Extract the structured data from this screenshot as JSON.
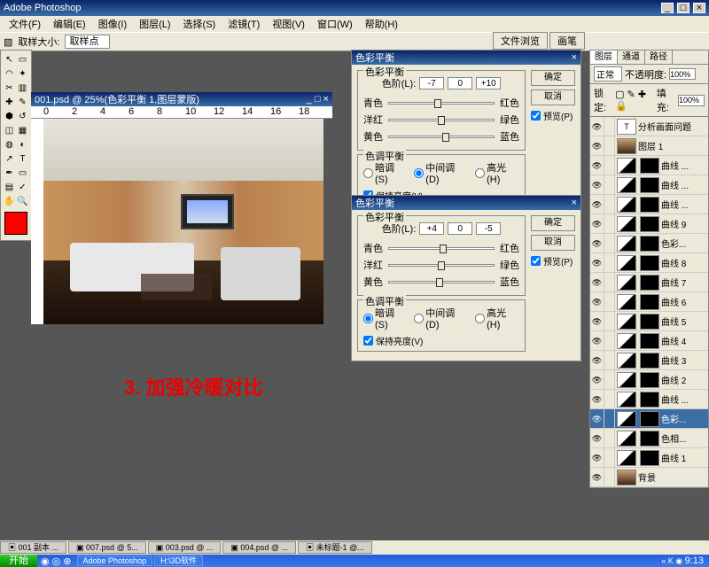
{
  "app": {
    "title": "Adobe Photoshop"
  },
  "menu": [
    "文件(F)",
    "编辑(E)",
    "图像(I)",
    "图层(L)",
    "选择(S)",
    "滤镜(T)",
    "视图(V)",
    "窗口(W)",
    "帮助(H)"
  ],
  "options": {
    "label": "取样大小:",
    "value": "取样点"
  },
  "topTabs": [
    "文件浏览",
    "画笔"
  ],
  "doc": {
    "title": "001.psd @ 25%(色彩平衡 1,图层蒙版)",
    "rulerMarks": [
      "0",
      "2",
      "4",
      "6",
      "8",
      "10",
      "12",
      "14",
      "16",
      "18"
    ]
  },
  "annotation": "3. 加强冷暖对比",
  "dlg1": {
    "title": "色彩平衡",
    "group1": "色彩平衡",
    "levelsLabel": "色阶(L):",
    "l1": "-7",
    "l2": "0",
    "l3": "+10",
    "rows": [
      [
        "青色",
        "红色"
      ],
      [
        "洋红",
        "绿色"
      ],
      [
        "黄色",
        "蓝色"
      ]
    ],
    "thumbs": [
      47,
      50,
      54
    ],
    "group2": "色调平衡",
    "radios": [
      "暗调(S)",
      "中间调(D)",
      "高光(H)"
    ],
    "radioSel": 1,
    "preserve": "保持亮度(V)",
    "ok": "确定",
    "cancel": "取消",
    "preview": "预览(P)"
  },
  "dlg2": {
    "title": "色彩平衡",
    "group1": "色彩平衡",
    "levelsLabel": "色阶(L):",
    "l1": "+4",
    "l2": "0",
    "l3": "-5",
    "rows": [
      [
        "青色",
        "红色"
      ],
      [
        "洋红",
        "绿色"
      ],
      [
        "黄色",
        "蓝色"
      ]
    ],
    "thumbs": [
      52,
      50,
      48
    ],
    "group2": "色调平衡",
    "radios": [
      "暗调(S)",
      "中间调(D)",
      "高光(H)"
    ],
    "radioSel": 0,
    "preserve": "保持亮度(V)",
    "ok": "确定",
    "cancel": "取消",
    "preview": "预览(P)"
  },
  "palette": {
    "tabs": [
      "图层",
      "通道",
      "路径"
    ],
    "blend": "正常",
    "opacityLabel": "不透明度:",
    "opacity": "100%",
    "lockLabel": "锁定:",
    "fillLabel": "填充:",
    "fill": "100%",
    "layers": [
      {
        "type": "text",
        "name": "分析画面问题",
        "th": "T"
      },
      {
        "type": "normal",
        "name": "图层 1",
        "th": "img"
      },
      {
        "type": "adj",
        "name": "曲线 ...",
        "th": "curve",
        "mask": true
      },
      {
        "type": "adj",
        "name": "曲线 ...",
        "th": "curve",
        "mask": true
      },
      {
        "type": "adj",
        "name": "曲线 ...",
        "th": "curve",
        "mask": true
      },
      {
        "type": "adj",
        "name": "曲线 9",
        "th": "curve",
        "mask": true
      },
      {
        "type": "adj",
        "name": "色彩...",
        "th": "curve",
        "mask": true
      },
      {
        "type": "adj",
        "name": "曲线 8",
        "th": "curve",
        "mask": true
      },
      {
        "type": "adj",
        "name": "曲线 7",
        "th": "curve",
        "mask": true
      },
      {
        "type": "adj",
        "name": "曲线 6",
        "th": "curve",
        "mask": true
      },
      {
        "type": "adj",
        "name": "曲线 5",
        "th": "curve",
        "mask": true
      },
      {
        "type": "adj",
        "name": "曲线 4",
        "th": "curve",
        "mask": true
      },
      {
        "type": "adj",
        "name": "曲线 3",
        "th": "curve",
        "mask": true
      },
      {
        "type": "adj",
        "name": "曲线 2",
        "th": "curve",
        "mask": true
      },
      {
        "type": "adj",
        "name": "曲线 ...",
        "th": "curve",
        "mask": true
      },
      {
        "type": "adj",
        "name": "色彩...",
        "th": "curve",
        "mask": true,
        "sel": true
      },
      {
        "type": "adj",
        "name": "色相...",
        "th": "curve",
        "mask": true
      },
      {
        "type": "adj",
        "name": "曲线 1",
        "th": "curve",
        "mask": true
      },
      {
        "type": "bg",
        "name": "背景",
        "th": "img"
      }
    ]
  },
  "taskbarDocs": [
    "001 副本 ...",
    "007.psd @ 5...",
    "003.psd @ ...",
    "004.psd @ ...",
    "未标题-1 @..."
  ],
  "winTask": {
    "start": "开始",
    "apps": [
      "Adobe Photoshop",
      "H:\\3D软件"
    ],
    "time": "9:13"
  }
}
